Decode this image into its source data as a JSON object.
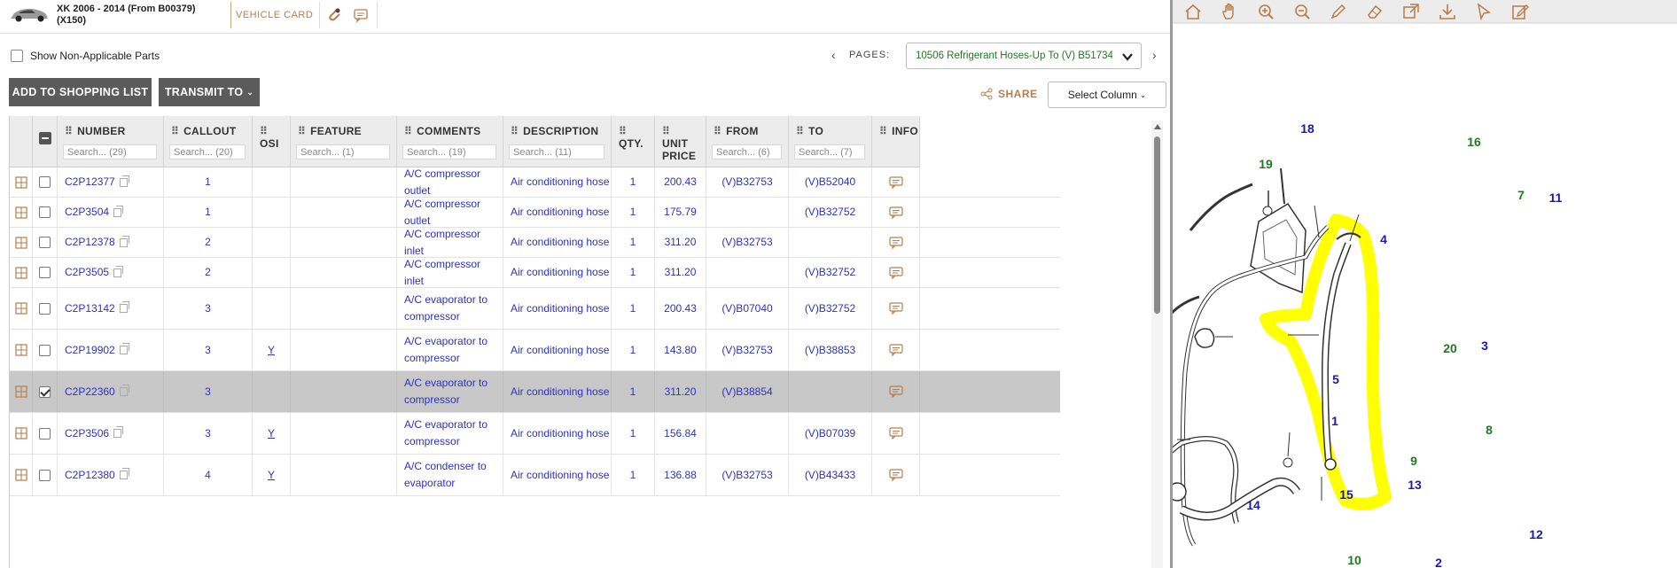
{
  "vehicle": {
    "name": "XK 2006 - 2014 (From B00379)",
    "code": "(X150)",
    "card_label": "VEHICLE CARD",
    "icons": [
      "car-thumbnail",
      "paperclip-icon",
      "comment-icon"
    ]
  },
  "options": {
    "show_non_applicable_label": "Show Non-Applicable Parts",
    "show_non_applicable_checked": false,
    "pages_label": "PAGES:",
    "pages_selected": "10506 Refrigerant Hoses-Up To (V) B51734"
  },
  "actions": {
    "add_to_list": "ADD TO SHOPPING LIST",
    "transmit": "TRANSMIT TO",
    "share": "SHARE",
    "select_column": "Select Column"
  },
  "table": {
    "columns": [
      {
        "key": "number",
        "title": "NUMBER",
        "filter": "Search... (29)"
      },
      {
        "key": "callout",
        "title": "CALLOUT",
        "filter": "Search... (20)"
      },
      {
        "key": "osi",
        "title": "OSI",
        "filter": ""
      },
      {
        "key": "feature",
        "title": "FEATURE",
        "filter": "Search... (1)"
      },
      {
        "key": "comments",
        "title": "COMMENTS",
        "filter": "Search... (19)"
      },
      {
        "key": "description",
        "title": "DESCRIPTION",
        "filter": "Search... (11)"
      },
      {
        "key": "qty",
        "title": "QTY.",
        "filter": ""
      },
      {
        "key": "unit_price",
        "title": "UNIT\nPRICE",
        "filter": ""
      },
      {
        "key": "from",
        "title": "FROM",
        "filter": "Search... (6)"
      },
      {
        "key": "to",
        "title": "TO",
        "filter": "Search... (7)"
      },
      {
        "key": "info",
        "title": "INFO",
        "filter": ""
      }
    ],
    "rows": [
      {
        "number": "C2P12377",
        "callout": "1",
        "osi": "",
        "feature": "",
        "comments": "A/C compressor outlet",
        "description": "Air conditioning hose",
        "qty": "1",
        "unit_price": "200.43",
        "from": "(V)B32753",
        "to": "(V)B52040",
        "selected": false
      },
      {
        "number": "C2P3504",
        "callout": "1",
        "osi": "",
        "feature": "",
        "comments": "A/C compressor outlet",
        "description": "Air conditioning hose",
        "qty": "1",
        "unit_price": "175.79",
        "from": "",
        "to": "(V)B32752",
        "selected": false
      },
      {
        "number": "C2P12378",
        "callout": "2",
        "osi": "",
        "feature": "",
        "comments": "A/C compressor inlet",
        "description": "Air conditioning hose",
        "qty": "1",
        "unit_price": "311.20",
        "from": "(V)B32753",
        "to": "",
        "selected": false
      },
      {
        "number": "C2P3505",
        "callout": "2",
        "osi": "",
        "feature": "",
        "comments": "A/C compressor inlet",
        "description": "Air conditioning hose",
        "qty": "1",
        "unit_price": "311.20",
        "from": "",
        "to": "(V)B32752",
        "selected": false
      },
      {
        "number": "C2P13142",
        "callout": "3",
        "osi": "",
        "feature": "",
        "comments": "A/C evaporator to compressor",
        "description": "Air conditioning hose",
        "qty": "1",
        "unit_price": "200.43",
        "from": "(V)B07040",
        "to": "(V)B32752",
        "selected": false
      },
      {
        "number": "C2P19902",
        "callout": "3",
        "osi": "Y",
        "feature": "",
        "comments": "A/C evaporator to compressor",
        "description": "Air conditioning hose",
        "qty": "1",
        "unit_price": "143.80",
        "from": "(V)B32753",
        "to": "(V)B38853",
        "selected": false
      },
      {
        "number": "C2P22360",
        "callout": "3",
        "osi": "",
        "feature": "",
        "comments": "A/C evaporator to compressor",
        "description": "Air conditioning hose",
        "qty": "1",
        "unit_price": "311.20",
        "from": "(V)B38854",
        "to": "",
        "selected": true
      },
      {
        "number": "C2P3506",
        "callout": "3",
        "osi": "Y",
        "feature": "",
        "comments": "A/C evaporator to compressor",
        "description": "Air conditioning hose",
        "qty": "1",
        "unit_price": "156.84",
        "from": "",
        "to": "(V)B07039",
        "selected": false
      },
      {
        "number": "C2P12380",
        "callout": "4",
        "osi": "Y",
        "feature": "",
        "comments": "A/C condenser to evaporator",
        "description": "Air conditioning hose",
        "qty": "1",
        "unit_price": "136.88",
        "from": "(V)B32753",
        "to": "(V)B43433",
        "selected": false
      }
    ]
  },
  "viewer": {
    "tools": [
      "home-icon",
      "hand-pan-icon",
      "zoom-in-icon",
      "zoom-out-icon",
      "pen-icon",
      "eraser-icon",
      "open-external-icon",
      "download-icon",
      "cursor-icon",
      "edit-note-icon"
    ],
    "callouts": [
      {
        "label": "18",
        "color": "#1a1aa8"
      },
      {
        "label": "19",
        "color": "#1e7a1e"
      },
      {
        "label": "16",
        "color": "#1e7a1e"
      },
      {
        "label": "7",
        "color": "#1e7a1e"
      },
      {
        "label": "11",
        "color": "#1a1aa8"
      },
      {
        "label": "4",
        "color": "#1a1aa8"
      },
      {
        "label": "3",
        "color": "#1a1aa8"
      },
      {
        "label": "20",
        "color": "#1e7a1e"
      },
      {
        "label": "5",
        "color": "#1a1aa8"
      },
      {
        "label": "1",
        "color": "#1a1aa8"
      },
      {
        "label": "8",
        "color": "#1e7a1e"
      },
      {
        "label": "9",
        "color": "#1e7a1e"
      },
      {
        "label": "13",
        "color": "#1a1aa8"
      },
      {
        "label": "15",
        "color": "#1a1aa8"
      },
      {
        "label": "14",
        "color": "#1a1aa8"
      },
      {
        "label": "10",
        "color": "#1e7a1e"
      },
      {
        "label": "12",
        "color": "#1a1aa8"
      },
      {
        "label": "2",
        "color": "#1a1aa8"
      }
    ],
    "highlight_color": "#ffff00"
  }
}
